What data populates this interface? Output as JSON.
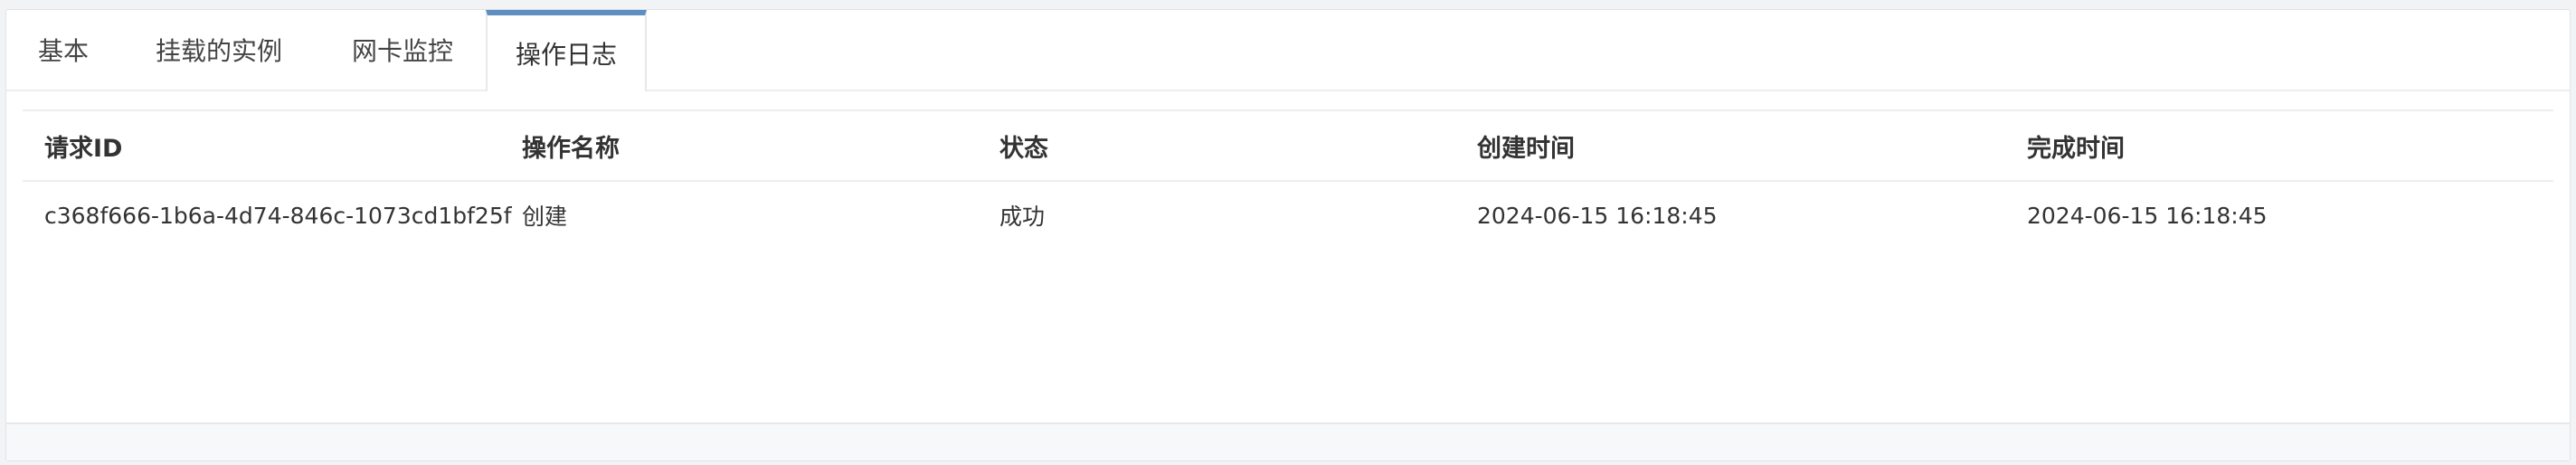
{
  "tabs": [
    {
      "label": "基本",
      "active": false
    },
    {
      "label": "挂载的实例",
      "active": false
    },
    {
      "label": "网卡监控",
      "active": false
    },
    {
      "label": "操作日志",
      "active": true
    }
  ],
  "table": {
    "headers": [
      "请求ID",
      "操作名称",
      "状态",
      "创建时间",
      "完成时间"
    ],
    "rows": [
      [
        "c368f666-1b6a-4d74-846c-1073cd1bf25f",
        "创建",
        "成功",
        "2024-06-15 16:18:45",
        "2024-06-15 16:18:45"
      ]
    ]
  },
  "colors": {
    "accent": "#5f8fc0",
    "background": "#f2f3f5",
    "panel": "#ffffff",
    "text": "#333333"
  }
}
